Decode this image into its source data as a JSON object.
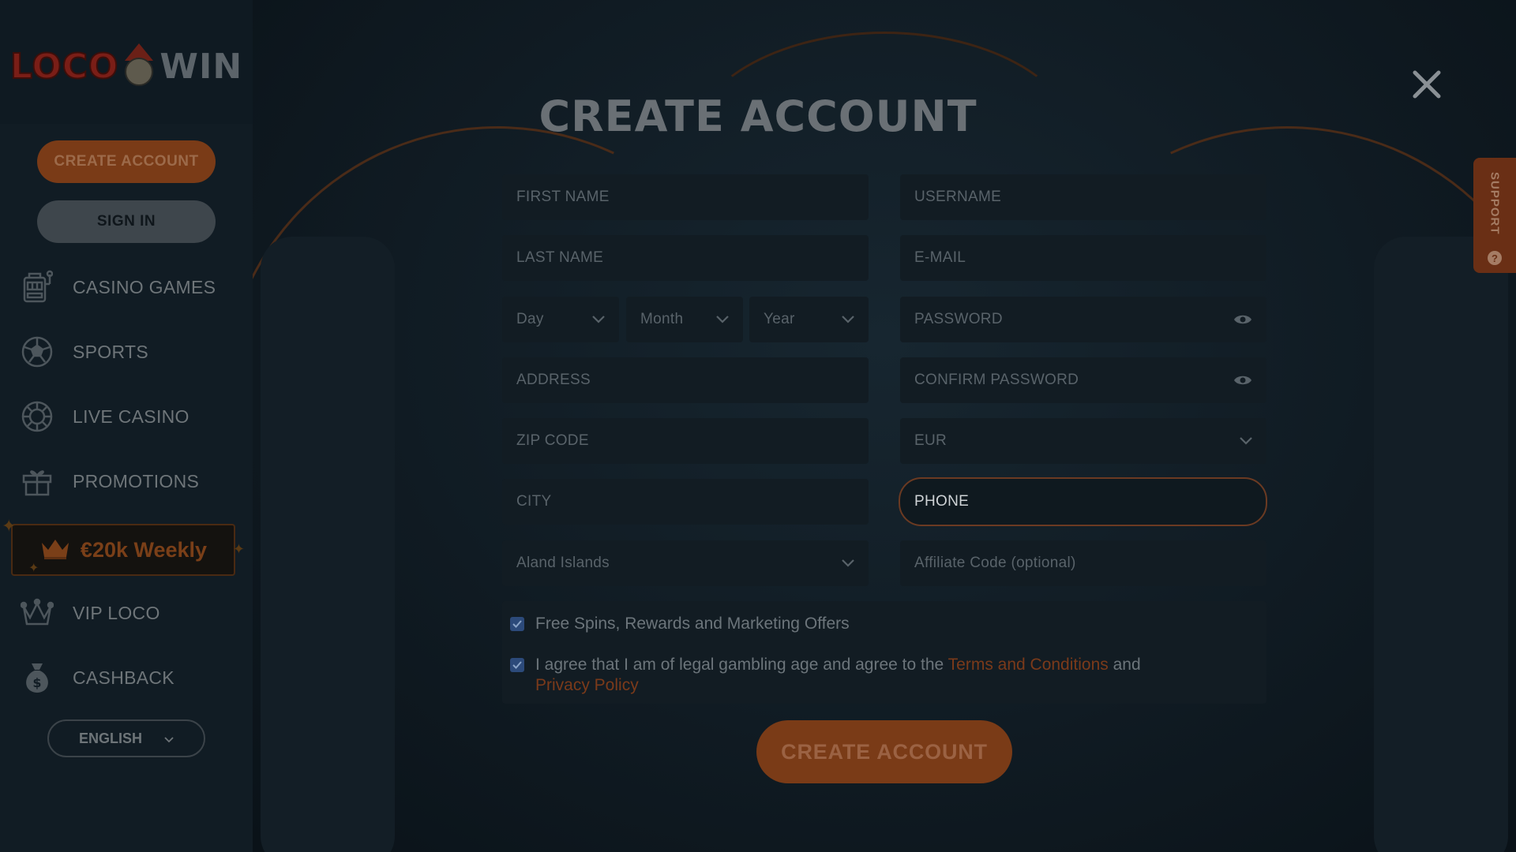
{
  "sidebar": {
    "logo": {
      "left": "LOCO",
      "right": "WIN"
    },
    "create_account_label": "CREATE ACCOUNT",
    "sign_in_label": "SIGN IN",
    "items": [
      {
        "label": "CASINO GAMES",
        "icon": "slot-machine-icon"
      },
      {
        "label": "SPORTS",
        "icon": "soccer-ball-icon"
      },
      {
        "label": "LIVE CASINO",
        "icon": "casino-chip-icon"
      },
      {
        "label": "PROMOTIONS",
        "icon": "gift-icon"
      }
    ],
    "promo": {
      "label": "€20k Weekly",
      "icon": "crown-icon"
    },
    "items2": [
      {
        "label": "VIP LOCO",
        "icon": "jester-crown-icon"
      },
      {
        "label": "CASHBACK",
        "icon": "money-bag-icon"
      }
    ],
    "language": "ENGLISH"
  },
  "modal": {
    "title": "CREATE ACCOUNT",
    "fields": {
      "first_name": "FIRST NAME",
      "username": "USERNAME",
      "last_name": "LAST NAME",
      "email": "E-MAIL",
      "day": "Day",
      "month": "Month",
      "year": "Year",
      "password": "PASSWORD",
      "address": "ADDRESS",
      "confirm_password": "CONFIRM PASSWORD",
      "zip_code": "ZIP CODE",
      "currency": "EUR",
      "city": "CITY",
      "phone": "PHONE",
      "country": "Aland Islands",
      "affiliate_code": "Affiliate Code (optional)"
    },
    "checks": {
      "marketing": "Free Spins, Rewards and Marketing Offers",
      "terms_prefix": "I agree that I am of legal gambling age and agree to the",
      "terms_link": "Terms and Conditions",
      "terms_and": "and",
      "privacy_link": "Privacy Policy"
    },
    "submit_label": "CREATE ACCOUNT"
  },
  "support": {
    "label": "SUPPORT",
    "icon": "?"
  },
  "colors": {
    "accent": "#7a3b17",
    "link": "#7b3a1a",
    "checkbox": "#2c4a7a"
  }
}
